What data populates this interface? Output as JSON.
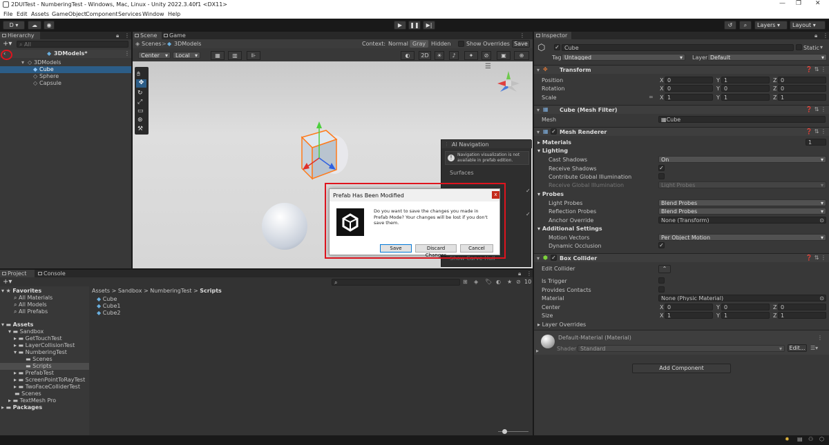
{
  "window": {
    "title": "2DUITest - NumberingTest - Windows, Mac, Linux - Unity 2022.3.40f1 <DX11>",
    "minimize": "—",
    "restore": "❐",
    "close": "✕"
  },
  "menu": [
    "File",
    "Edit",
    "Assets",
    "GameObject",
    "Component",
    "Services",
    "Window",
    "Help"
  ],
  "toolbar": {
    "account": "D ▾",
    "layers": "Layers",
    "layout": "Layout"
  },
  "hierarchy": {
    "tab": "Hierarchy",
    "search_placeholder": "All",
    "prefab_root": "3DModels*",
    "root": "3DModels",
    "items": [
      "Cube",
      "Sphere",
      "Capsule"
    ],
    "selected": "Cube"
  },
  "scene": {
    "tabs": [
      "Scene",
      "Game"
    ],
    "breadcrumb_root": "Scenes",
    "breadcrumb_sep": ">",
    "breadcrumb_item": "3DModels",
    "context_label": "Context:",
    "context_options": [
      "Normal",
      "Gray",
      "Hidden"
    ],
    "context_selected": "Gray",
    "show_overrides": "Show Overrides",
    "save": "Save",
    "pivot": "Center",
    "space": "Local",
    "mode_2d": "2D",
    "nav_overlay": {
      "title": "AI Navigation",
      "info": "Navigation visualization is not available in prefab edition.",
      "surfaces": "Surfaces",
      "show_carve_hull": "Show Carve Hull"
    }
  },
  "dialog": {
    "title": "Prefab Has Been Modified",
    "message": "Do you want to save the changes you made in Prefab Mode? Your changes will be lost if you don't save them.",
    "buttons": [
      "Save",
      "Discard Changes",
      "Cancel"
    ],
    "close": "x"
  },
  "project": {
    "tabs": [
      "Project",
      "Console"
    ],
    "favorites_label": "Favorites",
    "favorites": [
      "All Materials",
      "All Models",
      "All Prefabs"
    ],
    "assets_label": "Assets",
    "tree": [
      {
        "label": "Sandbox",
        "depth": 1
      },
      {
        "label": "GetTouchTest",
        "depth": 2
      },
      {
        "label": "LayerCollisionTest",
        "depth": 2
      },
      {
        "label": "NumberingTest",
        "depth": 2
      },
      {
        "label": "Scenes",
        "depth": 3
      },
      {
        "label": "Scripts",
        "depth": 3
      },
      {
        "label": "PrefabTest",
        "depth": 2
      },
      {
        "label": "ScreenPointToRayTest",
        "depth": 2
      },
      {
        "label": "TwoFaceColliderTest",
        "depth": 2
      },
      {
        "label": "Scenes",
        "depth": 1
      },
      {
        "label": "TextMesh Pro",
        "depth": 1
      }
    ],
    "packages_label": "Packages",
    "breadcrumb": [
      "Assets",
      "Sandbox",
      "NumberingTest",
      "Scripts"
    ],
    "files": [
      "Cube",
      "Cube1",
      "Cube2"
    ],
    "hidden_count": "10"
  },
  "inspector": {
    "tab": "Inspector",
    "object_name": "Cube",
    "static_label": "Static",
    "tag_label": "Tag",
    "tag_value": "Untagged",
    "layer_label": "Layer",
    "layer_value": "Default",
    "transform": {
      "title": "Transform",
      "position": {
        "label": "Position",
        "x": "0",
        "y": "1",
        "z": "0"
      },
      "rotation": {
        "label": "Rotation",
        "x": "0",
        "y": "0",
        "z": "0"
      },
      "scale": {
        "label": "Scale",
        "x": "1",
        "y": "1",
        "z": "1"
      }
    },
    "mesh_filter": {
      "title": "Cube (Mesh Filter)",
      "mesh_label": "Mesh",
      "mesh_value": "Cube"
    },
    "mesh_renderer": {
      "title": "Mesh Renderer",
      "materials_label": "Materials",
      "materials_count": "1",
      "lighting_label": "Lighting",
      "cast_shadows_label": "Cast Shadows",
      "cast_shadows_value": "On",
      "receive_shadows_label": "Receive Shadows",
      "contribute_gi_label": "Contribute Global Illumination",
      "receive_gi_label": "Receive Global Illumination",
      "receive_gi_value": "Light Probes",
      "probes_label": "Probes",
      "light_probes_label": "Light Probes",
      "light_probes_value": "Blend Probes",
      "reflection_probes_label": "Reflection Probes",
      "reflection_probes_value": "Blend Probes",
      "anchor_override_label": "Anchor Override",
      "anchor_override_value": "None (Transform)",
      "additional_label": "Additional Settings",
      "motion_vectors_label": "Motion Vectors",
      "motion_vectors_value": "Per Object Motion",
      "dynamic_occlusion_label": "Dynamic Occlusion"
    },
    "box_collider": {
      "title": "Box Collider",
      "edit_collider_label": "Edit Collider",
      "is_trigger_label": "Is Trigger",
      "provides_contacts_label": "Provides Contacts",
      "material_label": "Material",
      "material_value": "None (Physic Material)",
      "center": {
        "label": "Center",
        "x": "0",
        "y": "0",
        "z": "0"
      },
      "size": {
        "label": "Size",
        "x": "1",
        "y": "1",
        "z": "1"
      },
      "layer_overrides_label": "Layer Overrides"
    },
    "material": {
      "title": "Default-Material (Material)",
      "shader_label": "Shader",
      "shader_value": "Standard",
      "edit": "Edit..."
    },
    "add_component": "Add Component"
  },
  "colors": {
    "accent": "#2c5d87",
    "dialog_highlight": "#e0141e",
    "background": "#383838"
  }
}
